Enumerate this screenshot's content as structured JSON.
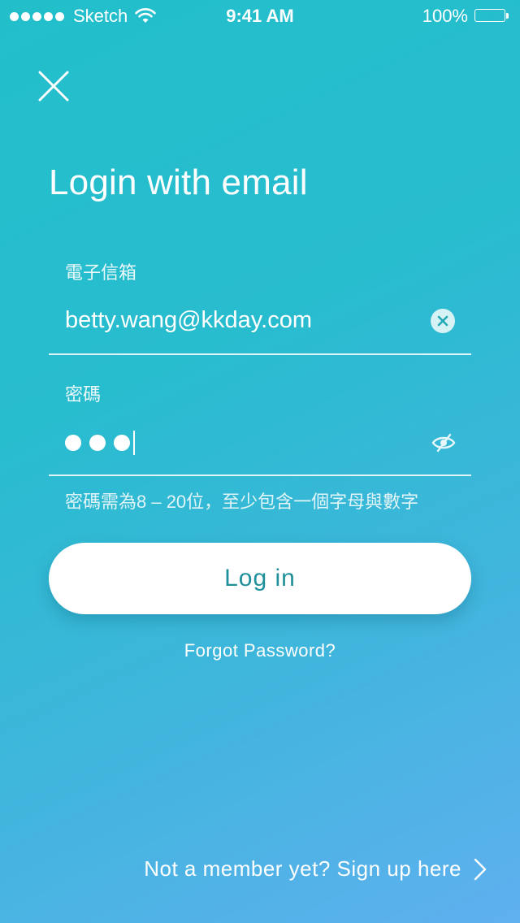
{
  "status_bar": {
    "carrier": "Sketch",
    "time": "9:41 AM",
    "battery_percent": "100%"
  },
  "title": "Login with email",
  "email": {
    "label": "電子信箱",
    "value": "betty.wang@kkday.com"
  },
  "password": {
    "label": "密碼",
    "masked_length": 3,
    "hint": "密碼需為8 – 20位，至少包含一個字母與數字"
  },
  "login_button": "Log in",
  "forgot_password": "Forgot Password?",
  "signup_link": "Not a member yet? Sign up here",
  "colors": {
    "gradient_start": "#22bfcb",
    "gradient_end": "#5fb0ef",
    "button_text": "#1f8f9a"
  },
  "icons": {
    "close": "close-icon",
    "clear": "clear-icon",
    "password_visibility": "eye-slash-icon",
    "signup_arrow": "chevron-right-icon",
    "wifi": "wifi-icon",
    "battery": "battery-icon"
  }
}
